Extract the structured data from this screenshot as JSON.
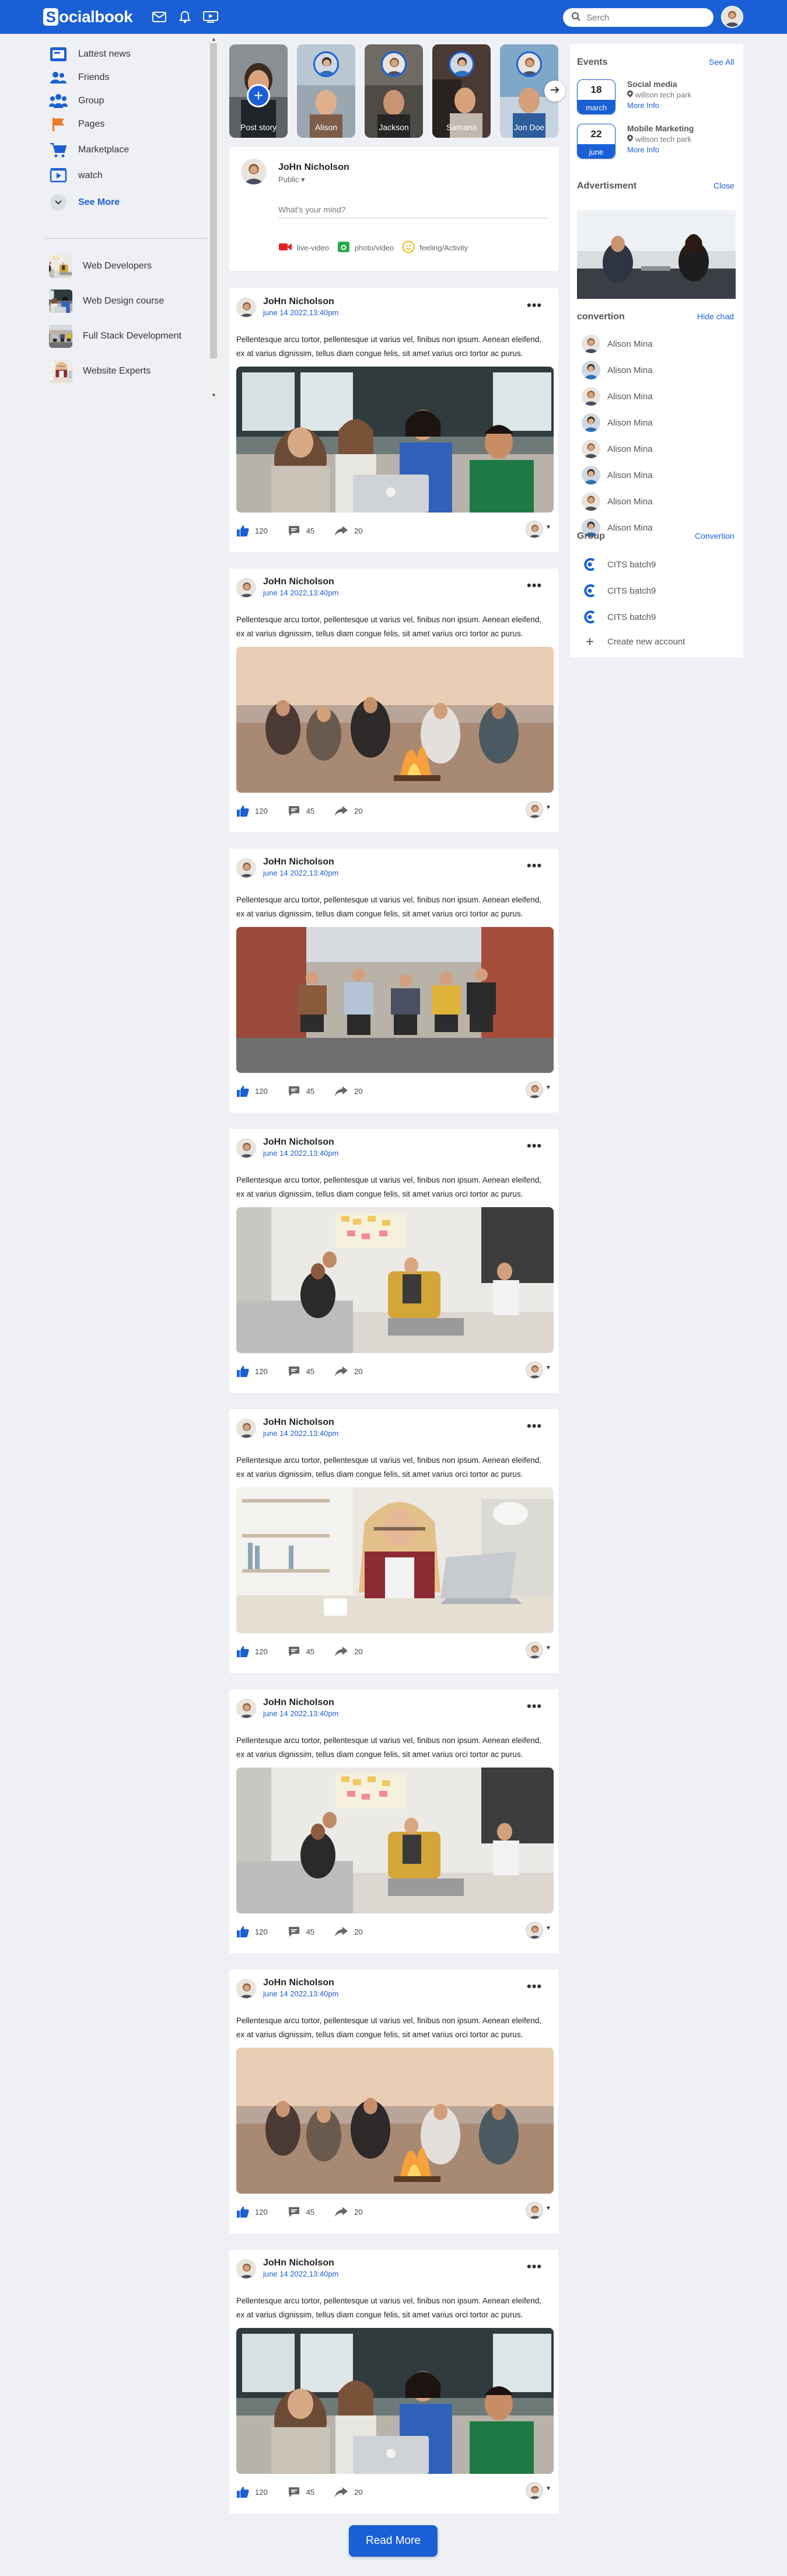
{
  "header": {
    "logo_letter": "S",
    "logo_rest": "ocialbook",
    "search_placeholder": "Serch",
    "icons": [
      "mail-icon",
      "bell-icon",
      "video-icon"
    ]
  },
  "sidebar": {
    "items": [
      {
        "label": "Lattest news",
        "icon": "news-icon"
      },
      {
        "label": "Friends",
        "icon": "friends-icon"
      },
      {
        "label": "Group",
        "icon": "group-icon"
      },
      {
        "label": "Pages",
        "icon": "flag-icon"
      },
      {
        "label": "Marketplace",
        "icon": "cart-icon"
      },
      {
        "label": "watch",
        "icon": "watch-icon"
      }
    ],
    "see_more": "See More",
    "groups": [
      {
        "label": "Web Developers"
      },
      {
        "label": "Web Design course"
      },
      {
        "label": "Full Stack Development"
      },
      {
        "label": "Website Experts"
      }
    ]
  },
  "stories": [
    {
      "name": "Post story"
    },
    {
      "name": "Alison"
    },
    {
      "name": "Jackson"
    },
    {
      "name": "Samana"
    },
    {
      "name": "Jon Doe"
    }
  ],
  "composer": {
    "name": "JoHn Nicholson",
    "visibility": "Public",
    "placeholder": "What's your mind?",
    "actions": [
      {
        "label": "live-video",
        "icon": "live-video-icon"
      },
      {
        "label": "photo/video",
        "icon": "photo-icon"
      },
      {
        "label": "feeling/Activity",
        "icon": "smile-icon"
      }
    ]
  },
  "posts": [
    {
      "name": "JoHn Nicholson",
      "time": "june 14 2022,13:40pm",
      "text": "Pellentesque arcu tortor, pellentesque ut varius vel, finibus non ipsum. Aenean eleifend, ex at varius dignissim, tellus diam congue felis, sit amet varius orci tortor ac purus.",
      "likes": "120",
      "comments": "45",
      "shares": "20",
      "image": "group of friends with laptop"
    },
    {
      "name": "JoHn Nicholson",
      "time": "june 14 2022,13:40pm",
      "text": "Pellentesque arcu tortor, pellentesque ut varius vel, finibus non ipsum. Aenean eleifend, ex at varius dignissim, tellus diam congue felis, sit amet varius orci tortor ac purus.",
      "likes": "120",
      "comments": "45",
      "shares": "20",
      "image": "friends at beach bonfire"
    },
    {
      "name": "JoHn Nicholson",
      "time": "june 14 2022,13:40pm",
      "text": "Pellentesque arcu tortor, pellentesque ut varius vel, finibus non ipsum. Aenean eleifend, ex at varius dignissim, tellus diam congue felis, sit amet varius orci tortor ac purus.",
      "likes": "120",
      "comments": "45",
      "shares": "20",
      "image": "friends walking on street"
    },
    {
      "name": "JoHn Nicholson",
      "time": "june 14 2022,13:40pm",
      "text": "Pellentesque arcu tortor, pellentesque ut varius vel, finibus non ipsum. Aenean eleifend, ex at varius dignissim, tellus diam congue felis, sit amet varius orci tortor ac purus.",
      "likes": "120",
      "comments": "45",
      "shares": "20",
      "image": "team meeting in office"
    },
    {
      "name": "JoHn Nicholson",
      "time": "june 14 2022,13:40pm",
      "text": "Pellentesque arcu tortor, pellentesque ut varius vel, finibus non ipsum. Aenean eleifend, ex at varius dignissim, tellus diam congue felis, sit amet varius orci tortor ac purus.",
      "likes": "120",
      "comments": "45",
      "shares": "20",
      "image": "woman working on laptop"
    },
    {
      "name": "JoHn Nicholson",
      "time": "june 14 2022,13:40pm",
      "text": "Pellentesque arcu tortor, pellentesque ut varius vel, finibus non ipsum. Aenean eleifend, ex at varius dignissim, tellus diam congue felis, sit amet varius orci tortor ac purus.",
      "likes": "120",
      "comments": "45",
      "shares": "20",
      "image": "team meeting in office"
    },
    {
      "name": "JoHn Nicholson",
      "time": "june 14 2022,13:40pm",
      "text": "Pellentesque arcu tortor, pellentesque ut varius vel, finibus non ipsum. Aenean eleifend, ex at varius dignissim, tellus diam congue felis, sit amet varius orci tortor ac purus.",
      "likes": "120",
      "comments": "45",
      "shares": "20",
      "image": "friends at beach bonfire"
    },
    {
      "name": "JoHn Nicholson",
      "time": "june 14 2022,13:40pm",
      "text": "Pellentesque arcu tortor, pellentesque ut varius vel, finibus non ipsum. Aenean eleifend, ex at varius dignissim, tellus diam congue felis, sit amet varius orci tortor ac purus.",
      "likes": "120",
      "comments": "45",
      "shares": "20",
      "image": "group of friends with laptop"
    }
  ],
  "right": {
    "events_title": "Events",
    "see_all": "See All",
    "events": [
      {
        "day": "18",
        "month": "march",
        "title": "Social media",
        "location": "willson tech park",
        "more": "More Info"
      },
      {
        "day": "22",
        "month": "june",
        "title": "Mobile Marketing",
        "location": "willson tech park",
        "more": "More Info"
      }
    ],
    "ad_title": "Advertisment",
    "ad_close": "Close",
    "conv_title": "convertion",
    "conv_hide": "Hide chad",
    "contacts": [
      "Alison Mina",
      "Alison Mina",
      "Alison Mina",
      "Alison Mina",
      "Alison Mina",
      "Alison Mina",
      "Alison Mina",
      "Alison Mina"
    ],
    "group_title": "Group",
    "group_link": "Convertion",
    "groups": [
      "CITS batch9",
      "CITS batch9",
      "CITS batch9"
    ],
    "create": "Create new account"
  },
  "read_more": "Read More",
  "colors": {
    "brand": "#1b5fd6",
    "background": "#eef0f5"
  }
}
